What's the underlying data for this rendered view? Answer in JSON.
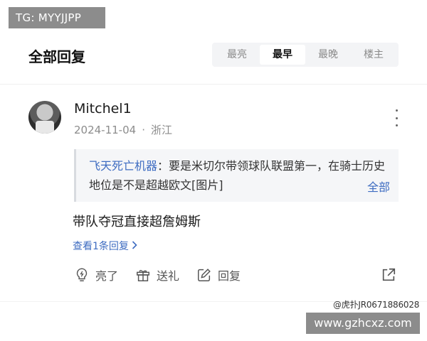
{
  "watermark_top": "TG: MYYJJPP",
  "header": {
    "title": "全部回复",
    "sort_tabs": [
      {
        "label": "最亮",
        "active": false
      },
      {
        "label": "最早",
        "active": true
      },
      {
        "label": "最晚",
        "active": false
      },
      {
        "label": "楼主",
        "active": false
      }
    ]
  },
  "comment": {
    "username": "Mitchel1",
    "date": "2024-11-04",
    "separator": "·",
    "location": "浙江",
    "quote": {
      "author": "飞天死亡机器",
      "text": "：要是米切尔带领球队联盟第一，在骑士历史地位是不是超越欧文[图片]",
      "expand_label": "全部"
    },
    "body": "带队夺冠直接超詹姆斯",
    "view_replies_label": "查看1条回复",
    "actions": {
      "like_label": "亮了",
      "gift_label": "送礼",
      "reply_label": "回复"
    }
  },
  "watermark_hupu": "@虎扑JR0671886028",
  "watermark_bottom": "www.gzhcxz.com",
  "colors": {
    "link": "#3e6cc1",
    "quote_bg": "#f5f6f8",
    "tab_bg": "#f3f4f6",
    "watermark_bg": "#8c8c8c"
  }
}
